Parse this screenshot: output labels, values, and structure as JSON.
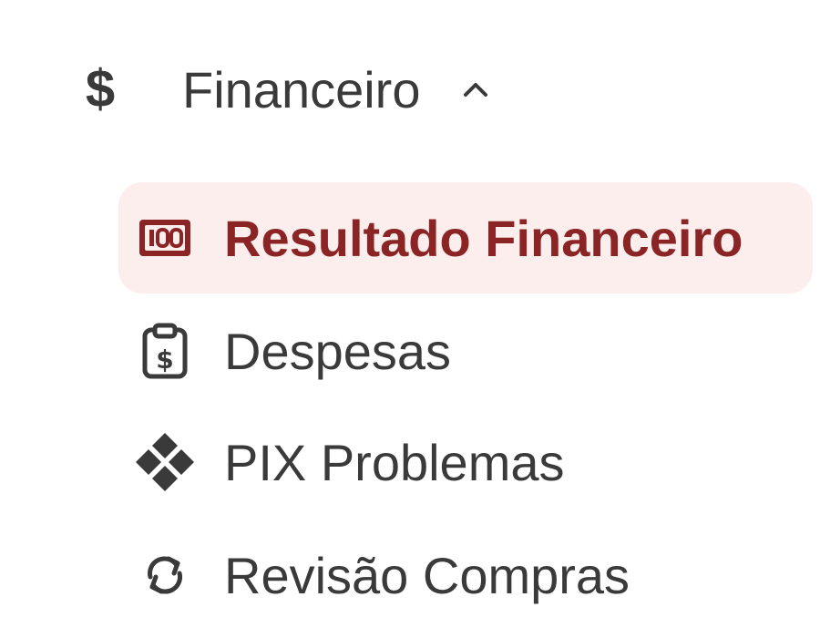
{
  "sidebar": {
    "group": {
      "icon": "dollar-icon",
      "symbol": "$",
      "label": "Financeiro",
      "expanded": true,
      "chevron_icon": "chevron-up-icon"
    },
    "items": [
      {
        "label": "Resultado Financeiro",
        "icon": "money-bill-icon",
        "active": true
      },
      {
        "label": "Despesas",
        "icon": "clipboard-dollar-icon",
        "active": false
      },
      {
        "label": "PIX Problemas",
        "icon": "pix-icon",
        "active": false
      },
      {
        "label": "Revisão Compras",
        "icon": "refresh-icon",
        "active": false
      }
    ]
  },
  "colors": {
    "active_text": "#8b2424",
    "active_background": "#fdeeee",
    "text": "#3a3a3a"
  }
}
